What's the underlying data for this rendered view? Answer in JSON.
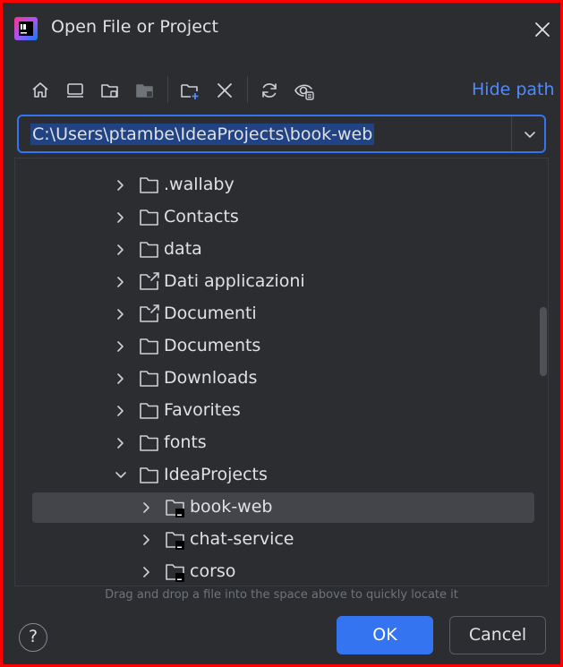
{
  "dialog": {
    "title": "Open File or Project"
  },
  "toolbar": {
    "icons": [
      "home-icon",
      "desktop-icon",
      "project-folder-icon",
      "module-folder-icon",
      "new-folder-icon",
      "delete-icon",
      "refresh-icon",
      "show-hidden-icon"
    ],
    "hide_path_label": "Hide path"
  },
  "path": {
    "value": "C:\\Users\\ptambe\\IdeaProjects\\book-web"
  },
  "tree": {
    "rows": [
      {
        "label": ".wallaby",
        "icon": "folder-icon",
        "expanded": false
      },
      {
        "label": "Contacts",
        "icon": "folder-icon",
        "expanded": false
      },
      {
        "label": "data",
        "icon": "folder-icon",
        "expanded": false
      },
      {
        "label": "Dati applicazioni",
        "icon": "folder-link-icon",
        "expanded": false
      },
      {
        "label": "Documenti",
        "icon": "folder-link-icon",
        "expanded": false
      },
      {
        "label": "Documents",
        "icon": "folder-icon",
        "expanded": false
      },
      {
        "label": "Downloads",
        "icon": "folder-icon",
        "expanded": false
      },
      {
        "label": "Favorites",
        "icon": "folder-icon",
        "expanded": false
      },
      {
        "label": "fonts",
        "icon": "folder-icon",
        "expanded": false
      },
      {
        "label": "IdeaProjects",
        "icon": "folder-icon",
        "expanded": true
      },
      {
        "label": "book-web",
        "icon": "project-folder-icon",
        "expanded": false,
        "selected": true
      },
      {
        "label": "chat-service",
        "icon": "project-folder-icon",
        "expanded": false
      },
      {
        "label": "corso",
        "icon": "project-folder-icon",
        "expanded": false
      }
    ]
  },
  "hint": "Drag and drop a file into the space above to quickly locate it",
  "footer": {
    "help_label": "?",
    "ok_label": "OK",
    "cancel_label": "Cancel"
  },
  "colors": {
    "accent": "#3574f0",
    "link": "#548af7",
    "background": "#2b2d30",
    "selection": "#43454a"
  }
}
